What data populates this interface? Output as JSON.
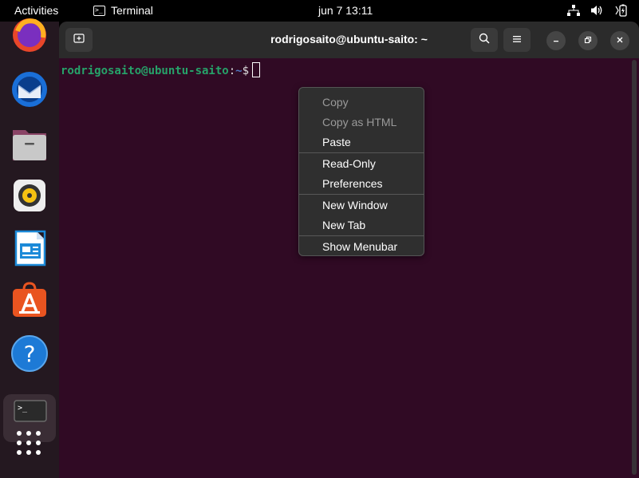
{
  "topbar": {
    "activities": "Activities",
    "app_name": "Terminal",
    "clock": "jun 7  13:11",
    "tray_icons": [
      "network-icon",
      "volume-icon",
      "battery-icon"
    ]
  },
  "dock": {
    "items": [
      "firefox-icon",
      "thunderbird-icon",
      "files-icon",
      "rhythmbox-icon",
      "libreoffice-writer-icon",
      "software-center-icon",
      "help-icon",
      "terminal-icon",
      "show-apps-icon"
    ]
  },
  "window": {
    "title": "rodrigosaito@ubuntu-saito: ~",
    "buttons": [
      "new-tab-icon",
      "search-icon",
      "menu-icon",
      "minimize-icon",
      "maximize-icon",
      "close-icon"
    ]
  },
  "terminal": {
    "prompt_user": "rodrigosaito@ubuntu-saito",
    "prompt_colon": ":",
    "prompt_path": "~",
    "prompt_dollar": "$"
  },
  "context_menu": {
    "copy": "Copy",
    "copy_html": "Copy as HTML",
    "paste": "Paste",
    "read_only": "Read-Only",
    "preferences": "Preferences",
    "new_window": "New Window",
    "new_tab": "New Tab",
    "show_menubar": "Show Menubar"
  },
  "colors": {
    "terminal_bg": "#300a24",
    "prompt_user": "#26a269",
    "prompt_path": "#5078c0",
    "headerbar": "#2b2b2b"
  }
}
